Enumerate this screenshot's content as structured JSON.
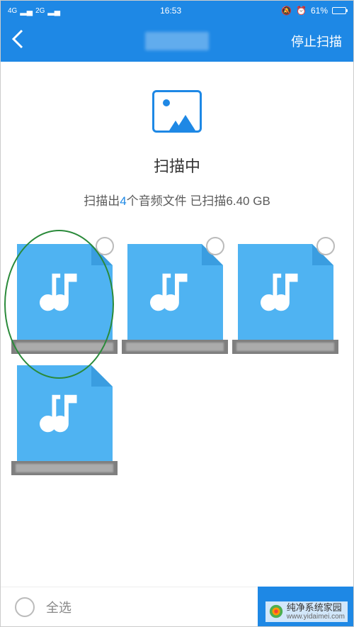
{
  "status": {
    "signal1": "4G",
    "signal2": "2G",
    "time": "16:53",
    "battery_pct": "61%"
  },
  "header": {
    "stop_scan": "停止扫描"
  },
  "scan": {
    "title": "扫描中",
    "prefix": "扫描出",
    "count": "4",
    "mid": "个音频文件 已扫描",
    "size": "6.40 GB"
  },
  "footer": {
    "select_all": "全选"
  },
  "watermark": {
    "name": "纯净系统家园",
    "url": "www.yidaimei.com"
  },
  "colors": {
    "primary": "#1e88e5",
    "file": "#4fb3f2"
  }
}
